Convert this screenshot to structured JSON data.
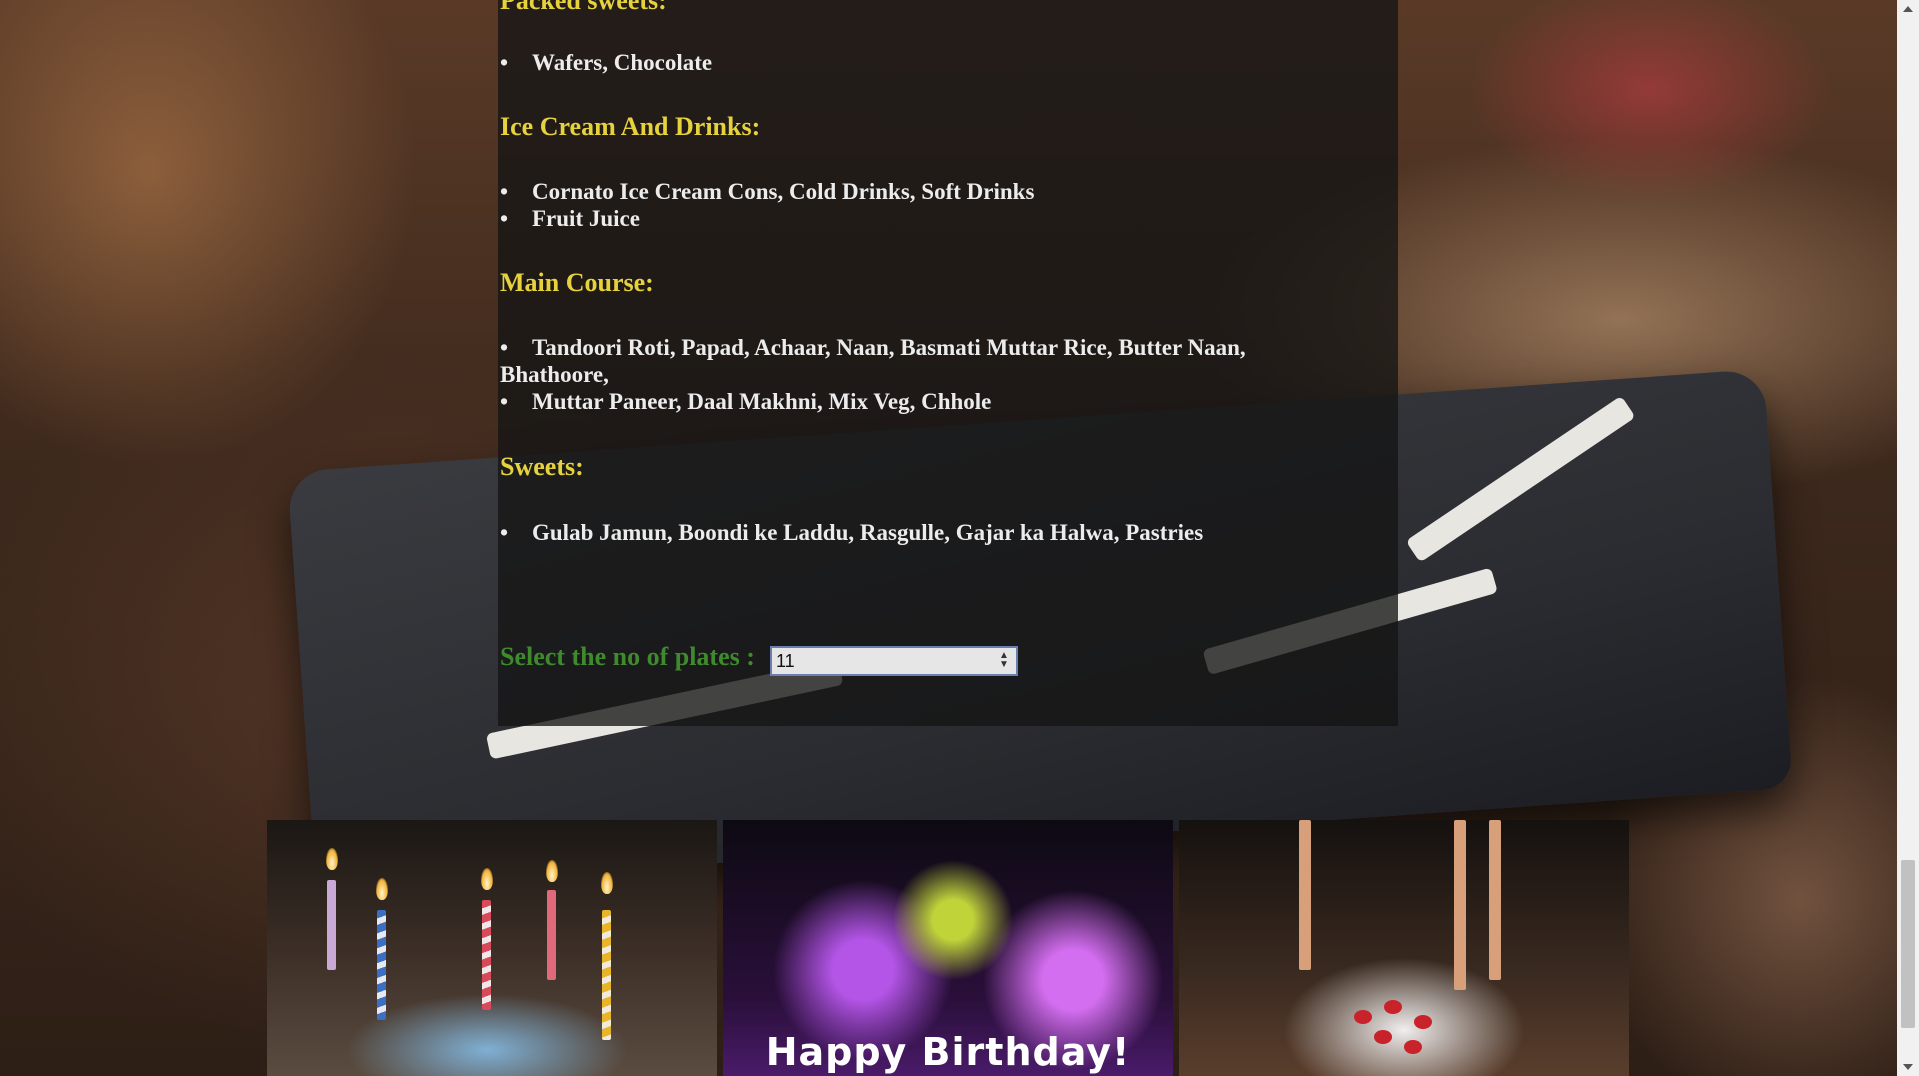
{
  "menu": {
    "sections": [
      {
        "heading": "Packed sweets:",
        "items": [
          "Wafers, Chocolate"
        ]
      },
      {
        "heading": "Ice Cream And Drinks:",
        "items": [
          "Cornato Ice Cream Cons, Cold Drinks, Soft Drinks",
          "Fruit Juice"
        ]
      },
      {
        "heading": "Main Course:",
        "items": [
          "Tandoori Roti, Papad, Achaar, Naan, Basmati Muttar Rice, Butter Naan, Bhathoore,",
          "Muttar Paneer, Daal Makhni, Mix Veg, Chhole"
        ]
      },
      {
        "heading": "Sweets:",
        "items": [
          "Gulab Jamun, Boondi ke Laddu, Rasgulle, Gajar ka Halwa, Pastries"
        ]
      }
    ],
    "bullet": "•"
  },
  "plates": {
    "label": "Select the no of plates :",
    "value": "11"
  },
  "gallery": {
    "banner_text": "Happy Birthday!"
  },
  "colors": {
    "heading": "#e6d23c",
    "item": "#ececec",
    "plates_label": "#3f8a2d",
    "panel": "rgba(20,20,20,0.78)"
  }
}
